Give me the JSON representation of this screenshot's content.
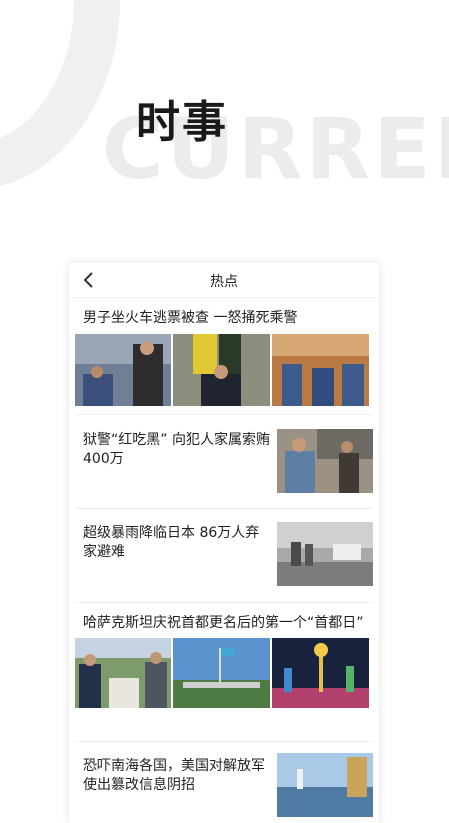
{
  "hero": {
    "title": "时事",
    "bg_word": "CURREN"
  },
  "card": {
    "nav_title": "热点",
    "items": [
      {
        "title": "男子坐火车逃票被查 一怒捅死乘警"
      },
      {
        "title": "狱警“红吃黑” 向犯人家属索贿400万"
      },
      {
        "title": "超级暴雨降临日本 86万人弃家避难"
      },
      {
        "title": "哈萨克斯坦庆祝首都更名后的第一个“首都日”"
      },
      {
        "title": "恐吓南海各国，美国对解放军使出篡改信息阴招"
      }
    ]
  },
  "colors": {
    "accent_text": "#222222",
    "divider": "#eeeeee",
    "background_word": "#ececec"
  }
}
